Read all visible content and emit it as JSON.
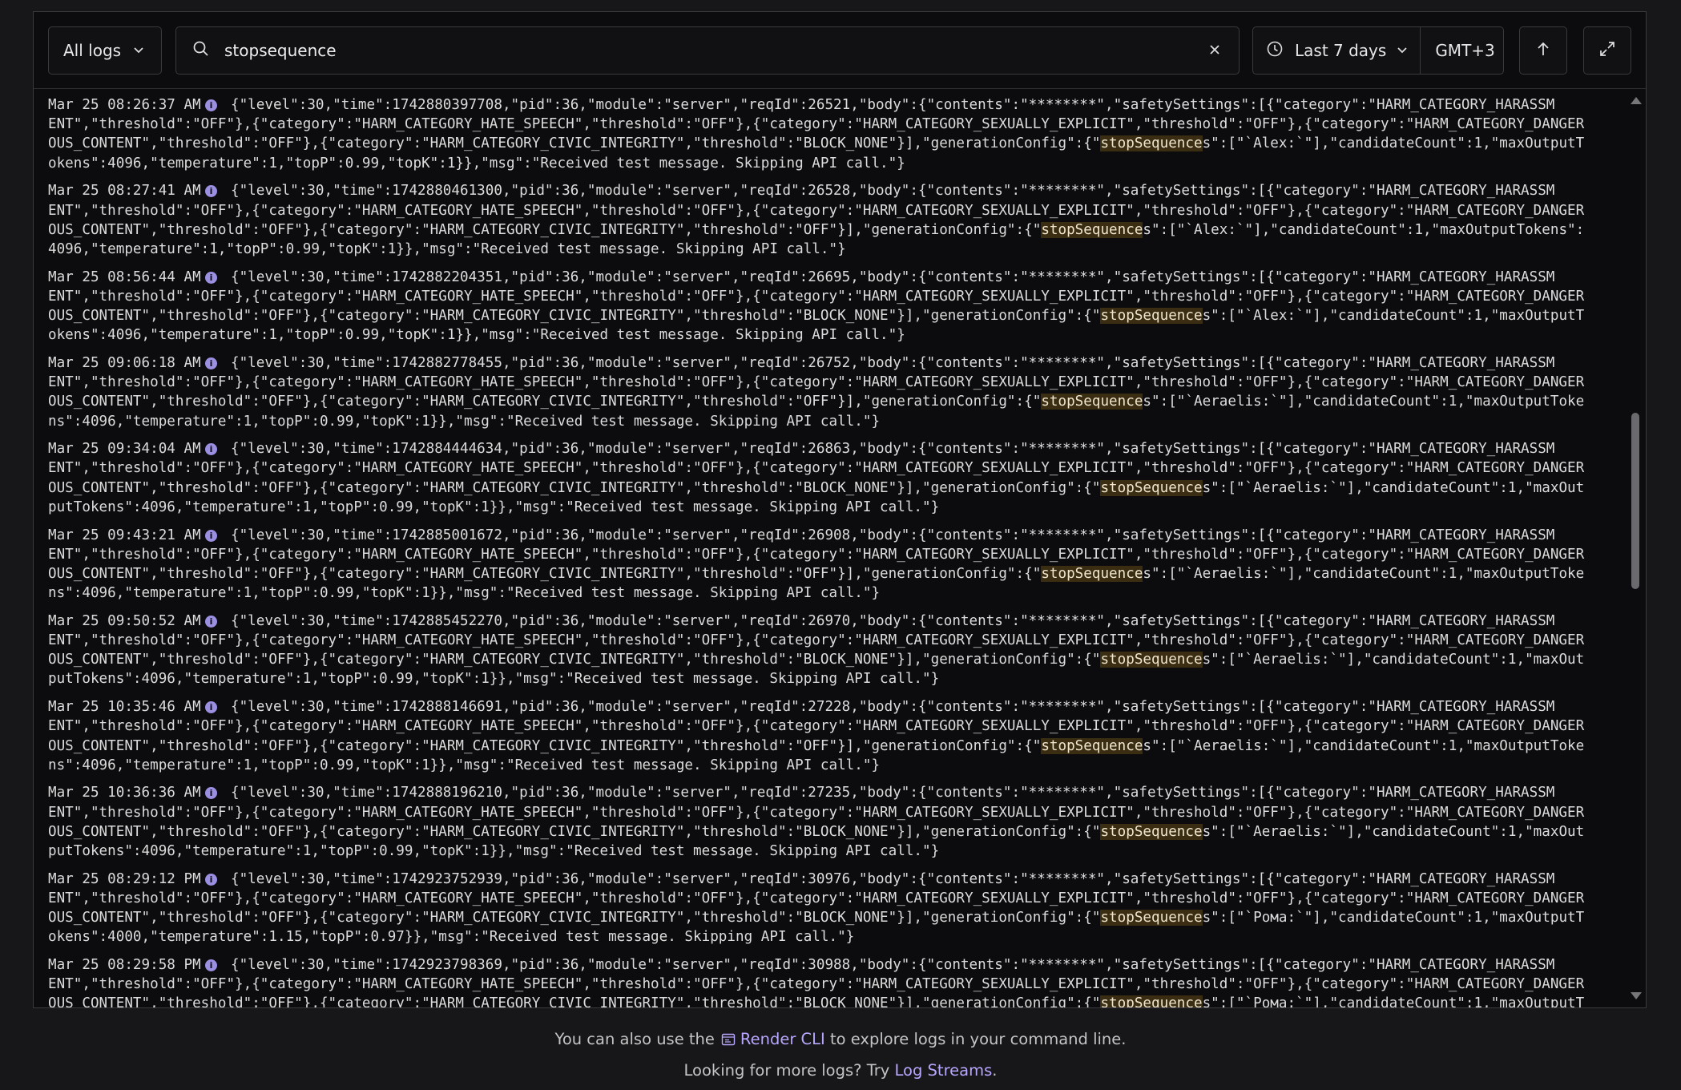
{
  "toolbar": {
    "log_filter": "All logs",
    "search_value": "stopsequence",
    "time_range": "Last 7 days",
    "timezone": "GMT+3"
  },
  "logs": [
    {
      "ts": "Mar 25 08:26:37 AM",
      "lines": [
        "{\"level\":30,\"time\":1742880397708,\"pid\":36,\"module\":\"server\",\"reqId\":26521,\"body\":{\"contents\":\"********\",\"safetySettings\":[{\"category\":\"HARM_CATEGORY_HARASSM",
        "ENT\",\"threshold\":\"OFF\"},{\"category\":\"HARM_CATEGORY_HATE_SPEECH\",\"threshold\":\"OFF\"},{\"category\":\"HARM_CATEGORY_SEXUALLY_EXPLICIT\",\"threshold\":\"OFF\"},{\"category\":\"HARM_CATEGORY_DANGER",
        "OUS_CONTENT\",\"threshold\":\"OFF\"},{\"category\":\"HARM_CATEGORY_CIVIC_INTEGRITY\",\"threshold\":\"BLOCK_NONE\"}],\"generationConfig\":{\"stopSequences\":[\"`Alex:`\"],\"candidateCount\":1,\"maxOutputT",
        "okens\":4096,\"temperature\":1,\"topP\":0.99,\"topK\":1}},\"msg\":\"Received test message. Skipping API call.\"}"
      ]
    },
    {
      "ts": "Mar 25 08:27:41 AM",
      "lines": [
        "{\"level\":30,\"time\":1742880461300,\"pid\":36,\"module\":\"server\",\"reqId\":26528,\"body\":{\"contents\":\"********\",\"safetySettings\":[{\"category\":\"HARM_CATEGORY_HARASSM",
        "ENT\",\"threshold\":\"OFF\"},{\"category\":\"HARM_CATEGORY_HATE_SPEECH\",\"threshold\":\"OFF\"},{\"category\":\"HARM_CATEGORY_SEXUALLY_EXPLICIT\",\"threshold\":\"OFF\"},{\"category\":\"HARM_CATEGORY_DANGER",
        "OUS_CONTENT\",\"threshold\":\"OFF\"},{\"category\":\"HARM_CATEGORY_CIVIC_INTEGRITY\",\"threshold\":\"OFF\"}],\"generationConfig\":{\"stopSequences\":[\"`Alex:`\"],\"candidateCount\":1,\"maxOutputTokens\":",
        "4096,\"temperature\":1,\"topP\":0.99,\"topK\":1}},\"msg\":\"Received test message. Skipping API call.\"}"
      ]
    },
    {
      "ts": "Mar 25 08:56:44 AM",
      "lines": [
        "{\"level\":30,\"time\":1742882204351,\"pid\":36,\"module\":\"server\",\"reqId\":26695,\"body\":{\"contents\":\"********\",\"safetySettings\":[{\"category\":\"HARM_CATEGORY_HARASSM",
        "ENT\",\"threshold\":\"OFF\"},{\"category\":\"HARM_CATEGORY_HATE_SPEECH\",\"threshold\":\"OFF\"},{\"category\":\"HARM_CATEGORY_SEXUALLY_EXPLICIT\",\"threshold\":\"OFF\"},{\"category\":\"HARM_CATEGORY_DANGER",
        "OUS_CONTENT\",\"threshold\":\"OFF\"},{\"category\":\"HARM_CATEGORY_CIVIC_INTEGRITY\",\"threshold\":\"BLOCK_NONE\"}],\"generationConfig\":{\"stopSequences\":[\"`Alex:`\"],\"candidateCount\":1,\"maxOutputT",
        "okens\":4096,\"temperature\":1,\"topP\":0.99,\"topK\":1}},\"msg\":\"Received test message. Skipping API call.\"}"
      ]
    },
    {
      "ts": "Mar 25 09:06:18 AM",
      "lines": [
        "{\"level\":30,\"time\":1742882778455,\"pid\":36,\"module\":\"server\",\"reqId\":26752,\"body\":{\"contents\":\"********\",\"safetySettings\":[{\"category\":\"HARM_CATEGORY_HARASSM",
        "ENT\",\"threshold\":\"OFF\"},{\"category\":\"HARM_CATEGORY_HATE_SPEECH\",\"threshold\":\"OFF\"},{\"category\":\"HARM_CATEGORY_SEXUALLY_EXPLICIT\",\"threshold\":\"OFF\"},{\"category\":\"HARM_CATEGORY_DANGER",
        "OUS_CONTENT\",\"threshold\":\"OFF\"},{\"category\":\"HARM_CATEGORY_CIVIC_INTEGRITY\",\"threshold\":\"OFF\"}],\"generationConfig\":{\"stopSequences\":[\"`Aeraelis:`\"],\"candidateCount\":1,\"maxOutputToke",
        "ns\":4096,\"temperature\":1,\"topP\":0.99,\"topK\":1}},\"msg\":\"Received test message. Skipping API call.\"}"
      ]
    },
    {
      "ts": "Mar 25 09:34:04 AM",
      "lines": [
        "{\"level\":30,\"time\":1742884444634,\"pid\":36,\"module\":\"server\",\"reqId\":26863,\"body\":{\"contents\":\"********\",\"safetySettings\":[{\"category\":\"HARM_CATEGORY_HARASSM",
        "ENT\",\"threshold\":\"OFF\"},{\"category\":\"HARM_CATEGORY_HATE_SPEECH\",\"threshold\":\"OFF\"},{\"category\":\"HARM_CATEGORY_SEXUALLY_EXPLICIT\",\"threshold\":\"OFF\"},{\"category\":\"HARM_CATEGORY_DANGER",
        "OUS_CONTENT\",\"threshold\":\"OFF\"},{\"category\":\"HARM_CATEGORY_CIVIC_INTEGRITY\",\"threshold\":\"BLOCK_NONE\"}],\"generationConfig\":{\"stopSequences\":[\"`Aeraelis:`\"],\"candidateCount\":1,\"maxOut",
        "putTokens\":4096,\"temperature\":1,\"topP\":0.99,\"topK\":1}},\"msg\":\"Received test message. Skipping API call.\"}"
      ]
    },
    {
      "ts": "Mar 25 09:43:21 AM",
      "lines": [
        "{\"level\":30,\"time\":1742885001672,\"pid\":36,\"module\":\"server\",\"reqId\":26908,\"body\":{\"contents\":\"********\",\"safetySettings\":[{\"category\":\"HARM_CATEGORY_HARASSM",
        "ENT\",\"threshold\":\"OFF\"},{\"category\":\"HARM_CATEGORY_HATE_SPEECH\",\"threshold\":\"OFF\"},{\"category\":\"HARM_CATEGORY_SEXUALLY_EXPLICIT\",\"threshold\":\"OFF\"},{\"category\":\"HARM_CATEGORY_DANGER",
        "OUS_CONTENT\",\"threshold\":\"OFF\"},{\"category\":\"HARM_CATEGORY_CIVIC_INTEGRITY\",\"threshold\":\"OFF\"}],\"generationConfig\":{\"stopSequences\":[\"`Aeraelis:`\"],\"candidateCount\":1,\"maxOutputToke",
        "ns\":4096,\"temperature\":1,\"topP\":0.99,\"topK\":1}},\"msg\":\"Received test message. Skipping API call.\"}"
      ]
    },
    {
      "ts": "Mar 25 09:50:52 AM",
      "lines": [
        "{\"level\":30,\"time\":1742885452270,\"pid\":36,\"module\":\"server\",\"reqId\":26970,\"body\":{\"contents\":\"********\",\"safetySettings\":[{\"category\":\"HARM_CATEGORY_HARASSM",
        "ENT\",\"threshold\":\"OFF\"},{\"category\":\"HARM_CATEGORY_HATE_SPEECH\",\"threshold\":\"OFF\"},{\"category\":\"HARM_CATEGORY_SEXUALLY_EXPLICIT\",\"threshold\":\"OFF\"},{\"category\":\"HARM_CATEGORY_DANGER",
        "OUS_CONTENT\",\"threshold\":\"OFF\"},{\"category\":\"HARM_CATEGORY_CIVIC_INTEGRITY\",\"threshold\":\"BLOCK_NONE\"}],\"generationConfig\":{\"stopSequences\":[\"`Aeraelis:`\"],\"candidateCount\":1,\"maxOut",
        "putTokens\":4096,\"temperature\":1,\"topP\":0.99,\"topK\":1}},\"msg\":\"Received test message. Skipping API call.\"}"
      ]
    },
    {
      "ts": "Mar 25 10:35:46 AM",
      "lines": [
        "{\"level\":30,\"time\":1742888146691,\"pid\":36,\"module\":\"server\",\"reqId\":27228,\"body\":{\"contents\":\"********\",\"safetySettings\":[{\"category\":\"HARM_CATEGORY_HARASSM",
        "ENT\",\"threshold\":\"OFF\"},{\"category\":\"HARM_CATEGORY_HATE_SPEECH\",\"threshold\":\"OFF\"},{\"category\":\"HARM_CATEGORY_SEXUALLY_EXPLICIT\",\"threshold\":\"OFF\"},{\"category\":\"HARM_CATEGORY_DANGER",
        "OUS_CONTENT\",\"threshold\":\"OFF\"},{\"category\":\"HARM_CATEGORY_CIVIC_INTEGRITY\",\"threshold\":\"OFF\"}],\"generationConfig\":{\"stopSequences\":[\"`Aeraelis:`\"],\"candidateCount\":1,\"maxOutputToke",
        "ns\":4096,\"temperature\":1,\"topP\":0.99,\"topK\":1}},\"msg\":\"Received test message. Skipping API call.\"}"
      ]
    },
    {
      "ts": "Mar 25 10:36:36 AM",
      "lines": [
        "{\"level\":30,\"time\":1742888196210,\"pid\":36,\"module\":\"server\",\"reqId\":27235,\"body\":{\"contents\":\"********\",\"safetySettings\":[{\"category\":\"HARM_CATEGORY_HARASSM",
        "ENT\",\"threshold\":\"OFF\"},{\"category\":\"HARM_CATEGORY_HATE_SPEECH\",\"threshold\":\"OFF\"},{\"category\":\"HARM_CATEGORY_SEXUALLY_EXPLICIT\",\"threshold\":\"OFF\"},{\"category\":\"HARM_CATEGORY_DANGER",
        "OUS_CONTENT\",\"threshold\":\"OFF\"},{\"category\":\"HARM_CATEGORY_CIVIC_INTEGRITY\",\"threshold\":\"BLOCK_NONE\"}],\"generationConfig\":{\"stopSequences\":[\"`Aeraelis:`\"],\"candidateCount\":1,\"maxOut",
        "putTokens\":4096,\"temperature\":1,\"topP\":0.99,\"topK\":1}},\"msg\":\"Received test message. Skipping API call.\"}"
      ]
    },
    {
      "ts": "Mar 25 08:29:12 PM",
      "lines": [
        "{\"level\":30,\"time\":1742923752939,\"pid\":36,\"module\":\"server\",\"reqId\":30976,\"body\":{\"contents\":\"********\",\"safetySettings\":[{\"category\":\"HARM_CATEGORY_HARASSM",
        "ENT\",\"threshold\":\"OFF\"},{\"category\":\"HARM_CATEGORY_HATE_SPEECH\",\"threshold\":\"OFF\"},{\"category\":\"HARM_CATEGORY_SEXUALLY_EXPLICIT\",\"threshold\":\"OFF\"},{\"category\":\"HARM_CATEGORY_DANGER",
        "OUS_CONTENT\",\"threshold\":\"OFF\"},{\"category\":\"HARM_CATEGORY_CIVIC_INTEGRITY\",\"threshold\":\"BLOCK_NONE\"}],\"generationConfig\":{\"stopSequences\":[\"`Рома:`\"],\"candidateCount\":1,\"maxOutputT",
        "okens\":4000,\"temperature\":1.15,\"topP\":0.97}},\"msg\":\"Received test message. Skipping API call.\"}"
      ]
    },
    {
      "ts": "Mar 25 08:29:58 PM",
      "lines": [
        "{\"level\":30,\"time\":1742923798369,\"pid\":36,\"module\":\"server\",\"reqId\":30988,\"body\":{\"contents\":\"********\",\"safetySettings\":[{\"category\":\"HARM_CATEGORY_HARASSM",
        "ENT\",\"threshold\":\"OFF\"},{\"category\":\"HARM_CATEGORY_HATE_SPEECH\",\"threshold\":\"OFF\"},{\"category\":\"HARM_CATEGORY_SEXUALLY_EXPLICIT\",\"threshold\":\"OFF\"},{\"category\":\"HARM_CATEGORY_DANGER",
        "OUS_CONTENT\",\"threshold\":\"OFF\"},{\"category\":\"HARM_CATEGORY_CIVIC_INTEGRITY\",\"threshold\":\"BLOCK_NONE\"}],\"generationConfig\":{\"stopSequences\":[\"`Рома:`\"],\"candidateCount\":1,\"maxOutputT"
      ]
    }
  ],
  "footer": {
    "line1_before": "You can also use the",
    "line1_link": "Render CLI",
    "line1_after": "to explore logs in your command line.",
    "line2_before": "Looking for more logs? Try",
    "line2_link": "Log Streams",
    "line2_after": "."
  },
  "colors": {
    "background": "#17171a",
    "panel": "#0c0c0e",
    "highlight": "#3a2d12",
    "link": "#b9a6ff",
    "info_icon": "#9a8fe0"
  }
}
